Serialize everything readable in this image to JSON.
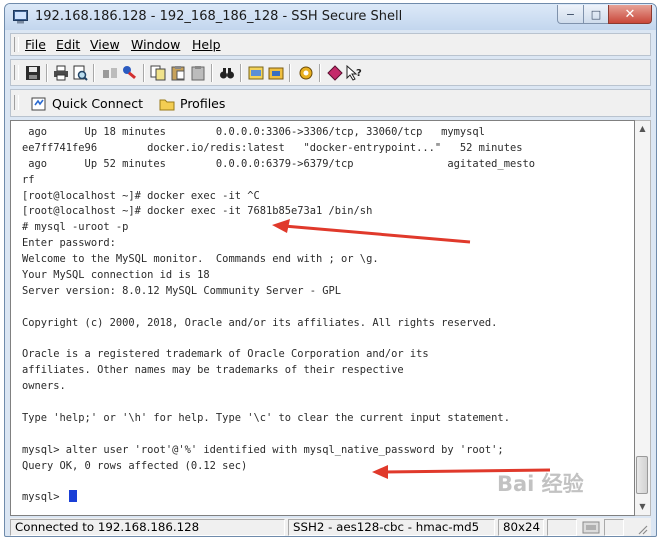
{
  "window": {
    "title": "192.168.186.128 - 192_168_186_128 - SSH Secure Shell",
    "controls": {
      "minimize": "−",
      "maximize": "□",
      "close": "✕"
    }
  },
  "menu": [
    "File",
    "Edit",
    "View",
    "Window",
    "Help"
  ],
  "toolbar_icons": [
    "save-icon",
    "print-icon",
    "print-preview-icon",
    "disconnect-icon",
    "key-icon",
    "copy-icon",
    "paste-icon",
    "paste-clipboard-icon",
    "find-icon",
    "settings-icon",
    "file-transfer-icon",
    "tools-icon",
    "stop-icon",
    "help-icon"
  ],
  "profilebar": {
    "quick_connect": "Quick Connect",
    "profiles": "Profiles"
  },
  "terminal": {
    "lines": [
      " ago      Up 18 minutes        0.0.0.0:3306->3306/tcp, 33060/tcp   mymysql",
      "ee7ff741fe96        docker.io/redis:latest   \"docker-entrypoint...\"   52 minutes",
      " ago      Up 52 minutes        0.0.0.0:6379->6379/tcp               agitated_mesto",
      "rf",
      "[root@localhost ~]# docker exec -it ^C",
      "[root@localhost ~]# docker exec -it 7681b85e73a1 /bin/sh",
      "# mysql -uroot -p",
      "Enter password:",
      "Welcome to the MySQL monitor.  Commands end with ; or \\g.",
      "Your MySQL connection id is 18",
      "Server version: 8.0.12 MySQL Community Server - GPL",
      "",
      "Copyright (c) 2000, 2018, Oracle and/or its affiliates. All rights reserved.",
      "",
      "Oracle is a registered trademark of Oracle Corporation and/or its",
      "affiliates. Other names may be trademarks of their respective",
      "owners.",
      "",
      "Type 'help;' or '\\h' for help. Type '\\c' to clear the current input statement.",
      "",
      "mysql> alter user 'root'@'%' identified with mysql_native_password by 'root';",
      "Query OK, 0 rows affected (0.12 sec)",
      "",
      "mysql> "
    ],
    "cursor_color": "#1a3fd6"
  },
  "statusbar": {
    "connection": "Connected to 192.168.186.128",
    "cipher": "SSH2 - aes128-cbc - hmac-md5",
    "size": "80x24"
  },
  "annotation_color": "#e0392b",
  "watermark": "Bai 经验"
}
